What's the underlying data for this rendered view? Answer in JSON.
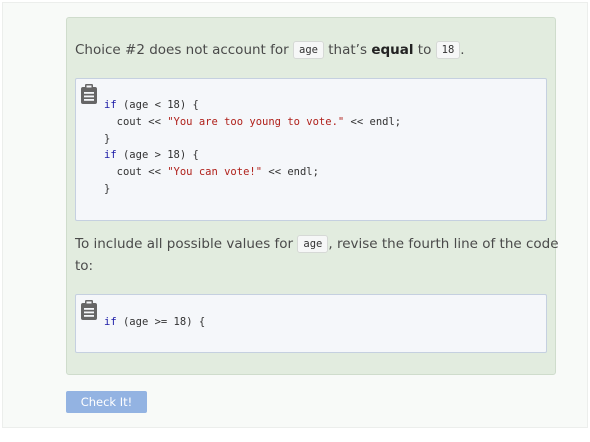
{
  "feedback": {
    "line1": {
      "before": "Choice #2 does not account for",
      "code1": "age",
      "middle": "that’s",
      "bold": "equal",
      "after": "to",
      "code2": "18",
      "end": "."
    },
    "code_block_1": {
      "icon": "clipboard-icon",
      "lines": [
        [
          {
            "t": "if",
            "c": "kw"
          },
          {
            "t": " (age < 18) {",
            "c": ""
          }
        ],
        [
          {
            "t": "  cout << ",
            "c": ""
          },
          {
            "t": "\"You are too young to vote.\"",
            "c": "str"
          },
          {
            "t": " << endl;",
            "c": ""
          }
        ],
        [
          {
            "t": "}",
            "c": ""
          }
        ],
        [
          {
            "t": "if",
            "c": "kw"
          },
          {
            "t": " (age > 18) {",
            "c": ""
          }
        ],
        [
          {
            "t": "  cout << ",
            "c": ""
          },
          {
            "t": "\"You can vote!\"",
            "c": "str"
          },
          {
            "t": " << endl;",
            "c": ""
          }
        ],
        [
          {
            "t": "}",
            "c": ""
          }
        ]
      ]
    },
    "line2": {
      "before": "To include all possible values for",
      "code": "age",
      "after": ", revise the fourth line of the code"
    },
    "line3": "to:",
    "code_block_2": {
      "icon": "clipboard-icon",
      "lines": [
        [
          {
            "t": "if",
            "c": "kw"
          },
          {
            "t": " (age >= 18) {",
            "c": ""
          }
        ]
      ]
    }
  },
  "check_button_label": "Check It!",
  "colors": {
    "feedback_bg": "#e2ecdf",
    "keyword": "#1a1aa6",
    "string": "#b0211b",
    "button_bg": "#93b3e2"
  }
}
